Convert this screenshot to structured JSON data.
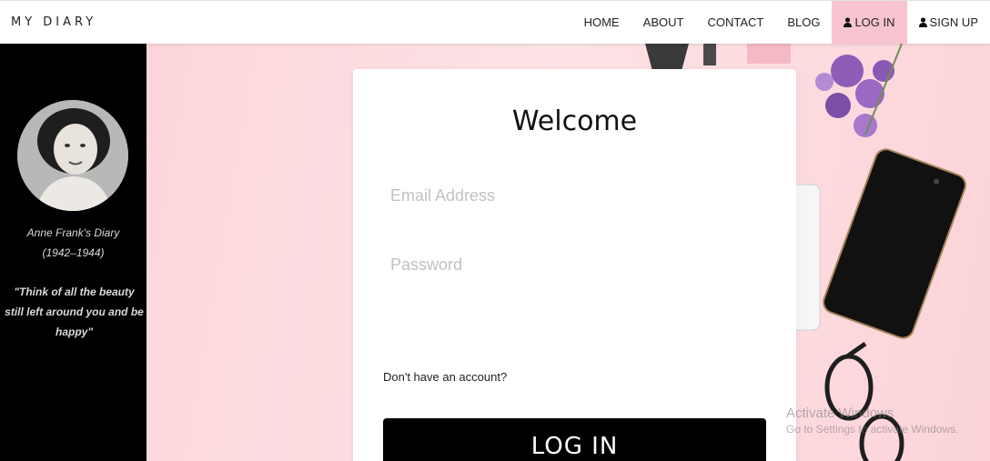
{
  "brand": "MY DIARY",
  "nav": {
    "items": [
      {
        "label": "HOME"
      },
      {
        "label": "ABOUT"
      },
      {
        "label": "CONTACT"
      },
      {
        "label": "BLOG"
      },
      {
        "label": "LOG IN",
        "icon": "user-icon",
        "active": true
      },
      {
        "label": "SIGN UP",
        "icon": "user-icon"
      }
    ],
    "active_color": "#f9c4d2"
  },
  "sidebar": {
    "caption_line1": "Anne Frank's Diary",
    "caption_line2": "(1942–1944)",
    "quote": "\"Think of all the beauty still left around you and be happy\""
  },
  "login": {
    "title": "Welcome",
    "email_placeholder": "Email Address",
    "password_placeholder": "Password",
    "signup_prompt": "Don't have an account?",
    "submit_label": "LOG IN"
  },
  "watermark": {
    "line1": "Activate Windows",
    "line2": "Go to Settings to activate Windows."
  },
  "colors": {
    "sidebar_bg": "#000000",
    "background_pink": "#fce4e6",
    "button_bg": "#000000"
  }
}
